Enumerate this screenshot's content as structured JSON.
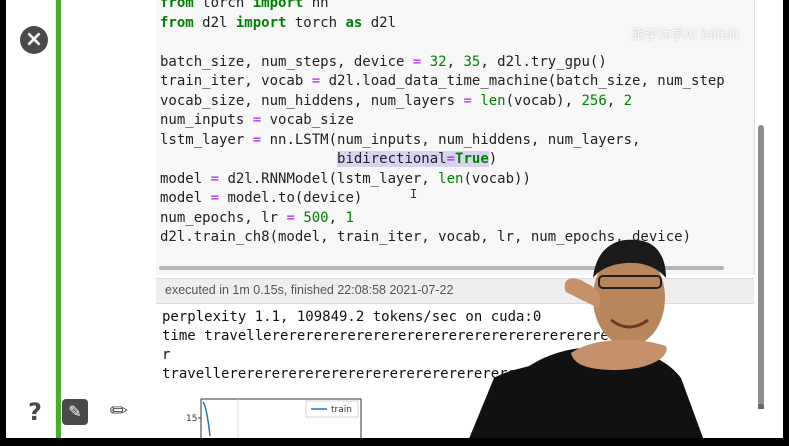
{
  "code_lines": [
    "from torch import nn",
    "from d2l import torch as d2l",
    "",
    "batch_size, num_steps, device = 32, 35, d2l.try_gpu()",
    "train_iter, vocab = d2l.load_data_time_machine(batch_size, num_step",
    "vocab_size, num_hiddens, num_layers = len(vocab), 256, 2",
    "num_inputs = vocab_size",
    "lstm_layer = nn.LSTM(num_inputs, num_hiddens, num_layers,",
    "                     bidirectional=True)",
    "model = d2l.RNNModel(lstm_layer, len(vocab))",
    "model = model.to(device)",
    "num_epochs, lr = 500, 1",
    "d2l.train_ch8(model, train_iter, vocab, lr, num_epochs, device)"
  ],
  "exec_status": "executed in 1m 0.15s, finished 22:08:58 2021-07-22",
  "output_lines": [
    "perplexity 1.1, 109849.2 tokens/sec on cuda:0",
    "time travellererererererererererererererererererererere",
    "r",
    "travellerererererererererererererererererererererererer"
  ],
  "plot": {
    "y_tick": "15",
    "legend": "train",
    "line_color": "#1f77b4"
  },
  "watermark": "跟李沐学AI bilibili",
  "icons": {
    "close": "close-icon",
    "help": "help-icon",
    "edit": "edit-icon",
    "pencil": "pencil-icon"
  },
  "colors": {
    "cell_bar": "#43b02a",
    "keyword": "#008000",
    "operator": "#aa22ff"
  }
}
